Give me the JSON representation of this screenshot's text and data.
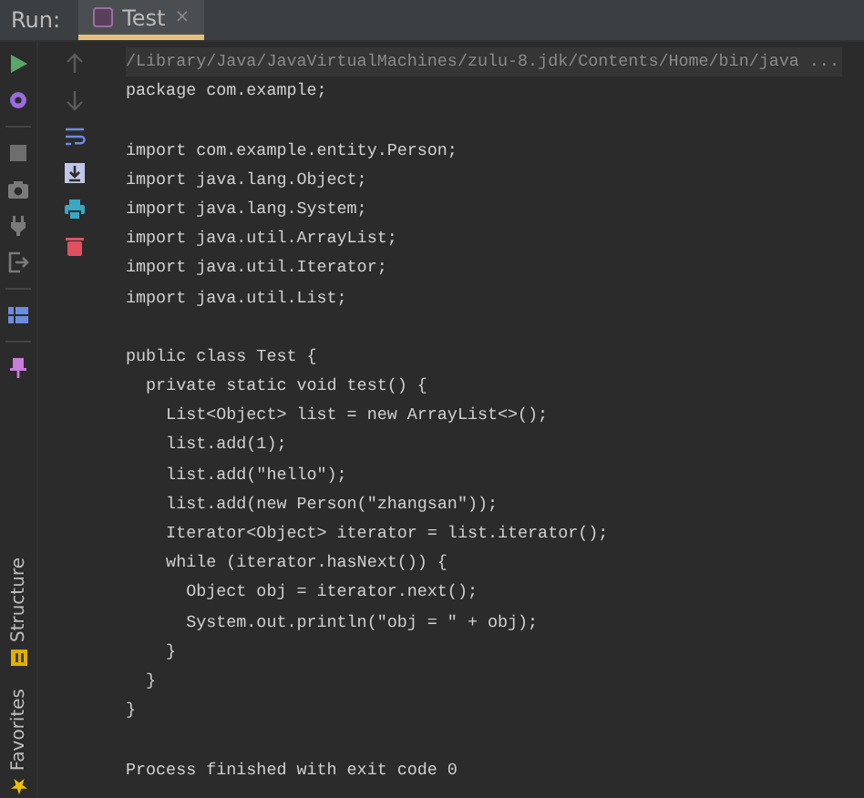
{
  "run_panel": {
    "label": "Run:",
    "tabs": [
      {
        "label": "Test",
        "selected": true,
        "close": "×"
      }
    ]
  },
  "side_tools": [
    {
      "label": "Structure",
      "kind": "structure"
    },
    {
      "label": "Favorites",
      "kind": "favorites"
    }
  ],
  "console": {
    "lines": [
      {
        "kind": "command",
        "text": "/Library/Java/JavaVirtualMachines/zulu-8.jdk/Contents/Home/bin/java ..."
      },
      {
        "kind": "output",
        "text": "package com.example;"
      },
      {
        "kind": "blank"
      },
      {
        "kind": "output",
        "text": "import com.example.entity.Person;"
      },
      {
        "kind": "output",
        "text": "import java.lang.Object;"
      },
      {
        "kind": "output",
        "text": "import java.lang.System;"
      },
      {
        "kind": "output",
        "text": "import java.util.ArrayList;"
      },
      {
        "kind": "output",
        "text": "import java.util.Iterator;"
      },
      {
        "kind": "output",
        "text": "import java.util.List;"
      },
      {
        "kind": "blank"
      },
      {
        "kind": "output",
        "text": "public class Test {"
      },
      {
        "kind": "output",
        "text": "  private static void test() {"
      },
      {
        "kind": "output",
        "text": "    List<Object> list = new ArrayList<>();"
      },
      {
        "kind": "output",
        "text": "    list.add(1);"
      },
      {
        "kind": "output",
        "text": "    list.add(\"hello\");"
      },
      {
        "kind": "output",
        "text": "    list.add(new Person(\"zhangsan\"));"
      },
      {
        "kind": "output",
        "text": "    Iterator<Object> iterator = list.iterator();"
      },
      {
        "kind": "output",
        "text": "    while (iterator.hasNext()) {"
      },
      {
        "kind": "output",
        "text": "      Object obj = iterator.next();"
      },
      {
        "kind": "output",
        "text": "      System.out.println(\"obj = \" + obj);"
      },
      {
        "kind": "output",
        "text": "    }"
      },
      {
        "kind": "output",
        "text": "  }"
      },
      {
        "kind": "output",
        "text": "}"
      },
      {
        "kind": "blank"
      },
      {
        "kind": "output",
        "text": "Process finished with exit code 0"
      }
    ]
  }
}
